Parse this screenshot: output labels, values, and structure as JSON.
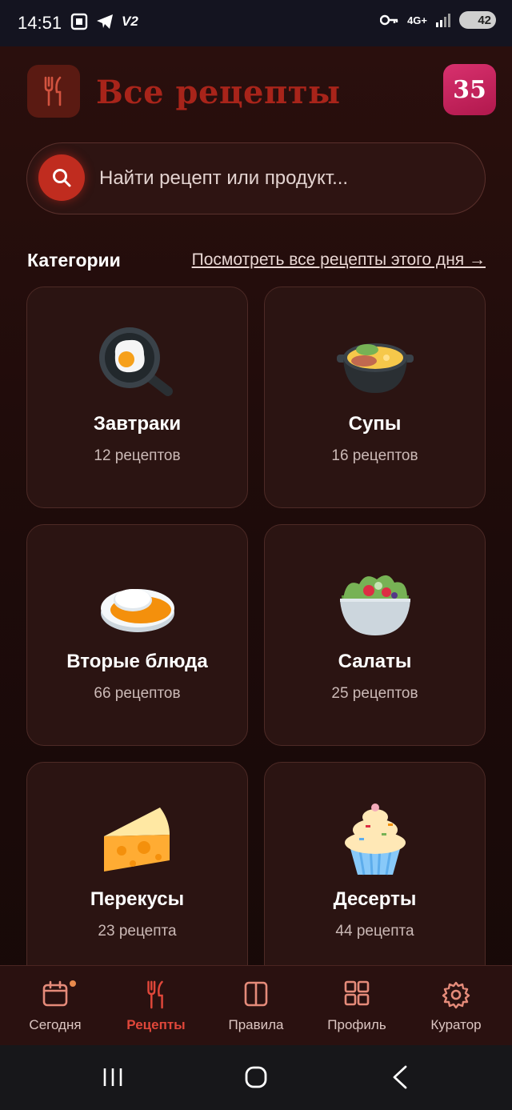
{
  "status_bar": {
    "time": "14:51",
    "left_icons": [
      "screenshot-icon",
      "telegram-icon"
    ],
    "vpn_label": "V2",
    "network_label": "4G+",
    "battery": "42"
  },
  "header": {
    "title": "Все рецепты",
    "logo_icon": "fork-knife-icon",
    "streak_value": "35"
  },
  "search": {
    "placeholder": "Найти рецепт или продукт..."
  },
  "categories": {
    "label": "Категории",
    "link_text": "Посмотреть все рецепты этого дня →",
    "items": [
      {
        "name": "Завтраки",
        "count": "12 рецептов",
        "icon": "fried-egg-pan-icon"
      },
      {
        "name": "Супы",
        "count": "16 рецептов",
        "icon": "soup-pot-icon"
      },
      {
        "name": "Вторые блюда",
        "count": "66 рецептов",
        "icon": "rice-curry-icon"
      },
      {
        "name": "Салаты",
        "count": "25 рецептов",
        "icon": "salad-bowl-icon"
      },
      {
        "name": "Перекусы",
        "count": "23 рецепта",
        "icon": "cheese-icon"
      },
      {
        "name": "Десерты",
        "count": "44 рецепта",
        "icon": "cupcake-icon"
      }
    ]
  },
  "bottom_nav": {
    "items": [
      {
        "label": "Сегодня",
        "icon": "calendar-icon",
        "active": false
      },
      {
        "label": "Рецепты",
        "icon": "fork-knife-icon",
        "active": true
      },
      {
        "label": "Правила",
        "icon": "book-icon",
        "active": false
      },
      {
        "label": "Профиль",
        "icon": "grid-icon",
        "active": false
      },
      {
        "label": "Куратор",
        "icon": "gear-icon",
        "active": false
      }
    ]
  },
  "colors": {
    "accent": "#c02c1f",
    "title": "#a8241a",
    "badge": "#c7245d",
    "background": "#1d0b0a"
  }
}
